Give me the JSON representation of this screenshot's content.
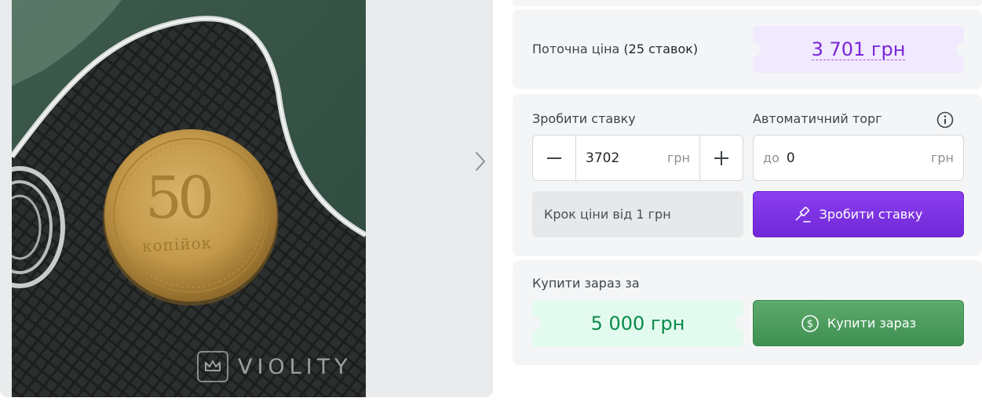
{
  "gallery": {
    "watermark": "VIOLITY",
    "coin_denomination": "50",
    "coin_text": "копійок",
    "next_icon": "chevron-right-icon"
  },
  "price": {
    "label": "Поточна ціна",
    "bids_count": "(25 ставок)",
    "current": "3 701 грн"
  },
  "bid": {
    "label": "Зробити ставку",
    "value": "3702",
    "currency": "грн",
    "minus_icon": "minus-icon",
    "plus_icon": "plus-icon",
    "step_info": "Крок ціни від 1 грн",
    "button_label": "Зробити ставку",
    "button_icon": "gavel-icon"
  },
  "auto": {
    "label": "Автоматичний торг",
    "prefix": "до",
    "value": "0",
    "currency": "грн",
    "info_icon": "info-icon"
  },
  "buy_now": {
    "label": "Купити зараз за",
    "price": "5 000 грн",
    "button_label": "Купити зараз",
    "button_icon": "dollar-coin-icon"
  },
  "colors": {
    "accent_purple": "#7a26d9",
    "price_ticket": "#f1e9fd",
    "buy_ticket": "#e3fbef",
    "buy_green": "#4a9a5c",
    "panel_bg": "#f4f5f6"
  }
}
